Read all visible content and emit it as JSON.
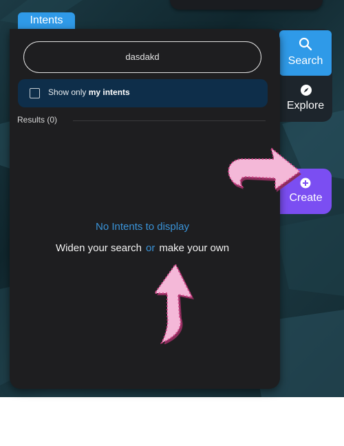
{
  "tabs": {
    "intents": "Intents"
  },
  "search": {
    "value": "dasdakd"
  },
  "filter": {
    "prefix": "Show only ",
    "emphasis": "my intents",
    "checked": false
  },
  "results": {
    "label": "Results (0)"
  },
  "empty_state": {
    "title": "No Intents to display",
    "widen": "Widen your search",
    "or": "or",
    "make_own": "make your own"
  },
  "nav": {
    "search": "Search",
    "explore": "Explore",
    "create": "Create"
  },
  "icons": {
    "search": "search-icon",
    "explore": "compass-icon",
    "create": "plus-circle-icon",
    "annotation": "arrow-icon"
  },
  "colors": {
    "accent_blue": "#2f9ae8",
    "create_purple": "#7b4ef2",
    "panel": "#1e1e20",
    "filter_bg": "#0e2e4a",
    "arrow_pink": "#f4b8d8"
  }
}
